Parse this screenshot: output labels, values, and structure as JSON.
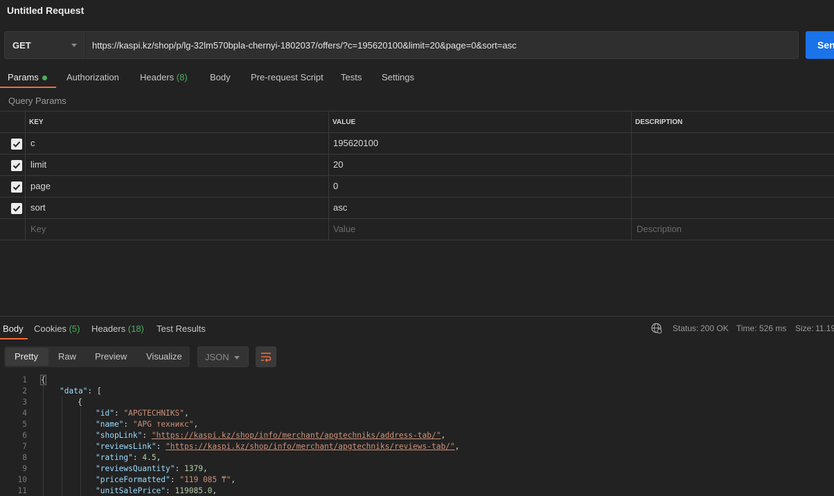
{
  "window": {
    "title": "Untitled Request"
  },
  "request": {
    "method": "GET",
    "url": "https://kaspi.kz/shop/p/lg-32lm570bpla-chernyi-1802037/offers/?c=195620100&limit=20&page=0&sort=asc",
    "send_label": "Send"
  },
  "request_tabs": {
    "params": "Params",
    "authorization": "Authorization",
    "headers": "Headers",
    "headers_count": "(8)",
    "body": "Body",
    "prerequest": "Pre-request Script",
    "tests": "Tests",
    "settings": "Settings"
  },
  "query_params": {
    "label": "Query Params",
    "headers": {
      "key": "KEY",
      "value": "VALUE",
      "description": "DESCRIPTION"
    },
    "rows": [
      {
        "key": "c",
        "value": "195620100",
        "description": "",
        "checked": true
      },
      {
        "key": "limit",
        "value": "20",
        "description": "",
        "checked": true
      },
      {
        "key": "page",
        "value": "0",
        "description": "",
        "checked": true
      },
      {
        "key": "sort",
        "value": "asc",
        "description": "",
        "checked": true
      }
    ],
    "placeholders": {
      "key": "Key",
      "value": "Value",
      "description": "Description"
    }
  },
  "response_tabs": {
    "body": "Body",
    "cookies": "Cookies",
    "cookies_count": "(5)",
    "headers": "Headers",
    "headers_count": "(18)",
    "test_results": "Test Results"
  },
  "response_meta": {
    "status_label": "Status:",
    "status_value": "200 OK",
    "time_label": "Time:",
    "time_value": "526 ms",
    "size_label": "Size:",
    "size_value": "11.19"
  },
  "view_modes": {
    "pretty": "Pretty",
    "raw": "Raw",
    "preview": "Preview",
    "visualize": "Visualize"
  },
  "format_select": "JSON",
  "code_lines": {
    "n1": "1",
    "n2": "2",
    "n3": "3",
    "n4": "4",
    "n5": "5",
    "n6": "6",
    "n7": "7",
    "n8": "8",
    "n9": "9",
    "n10": "10",
    "n11": "11",
    "l1": "{",
    "l2_key": "\"data\"",
    "l2_rest": ": [",
    "l3": "{",
    "l4_key": "\"id\"",
    "l4_val": "\"APGTECHNIKS\"",
    "l5_key": "\"name\"",
    "l5_val": "\"APG техникс\"",
    "l6_key": "\"shopLink\"",
    "l6_val": "\"https://kaspi.kz/shop/info/merchant/apgtechniks/address-tab/\"",
    "l7_key": "\"reviewsLink\"",
    "l7_val": "\"https://kaspi.kz/shop/info/merchant/apgtechniks/reviews-tab/\"",
    "l8_key": "\"rating\"",
    "l8_val": "4.5",
    "l9_key": "\"reviewsQuantity\"",
    "l9_val": "1379",
    "l10_key": "\"priceFormatted\"",
    "l10_val": "\"119 085 ₸\"",
    "l11_key": "\"unitSalePrice\"",
    "l11_val": "119085.0"
  },
  "colors": {
    "accent": "#f26b3a",
    "send": "#1a73e8",
    "status_green": "#49b060",
    "background": "#222222"
  },
  "icons": {
    "method_dropdown": "chevron-down-icon",
    "checkbox": "check-icon",
    "globe": "globe-icon",
    "wrap": "wrap-lines-icon"
  }
}
